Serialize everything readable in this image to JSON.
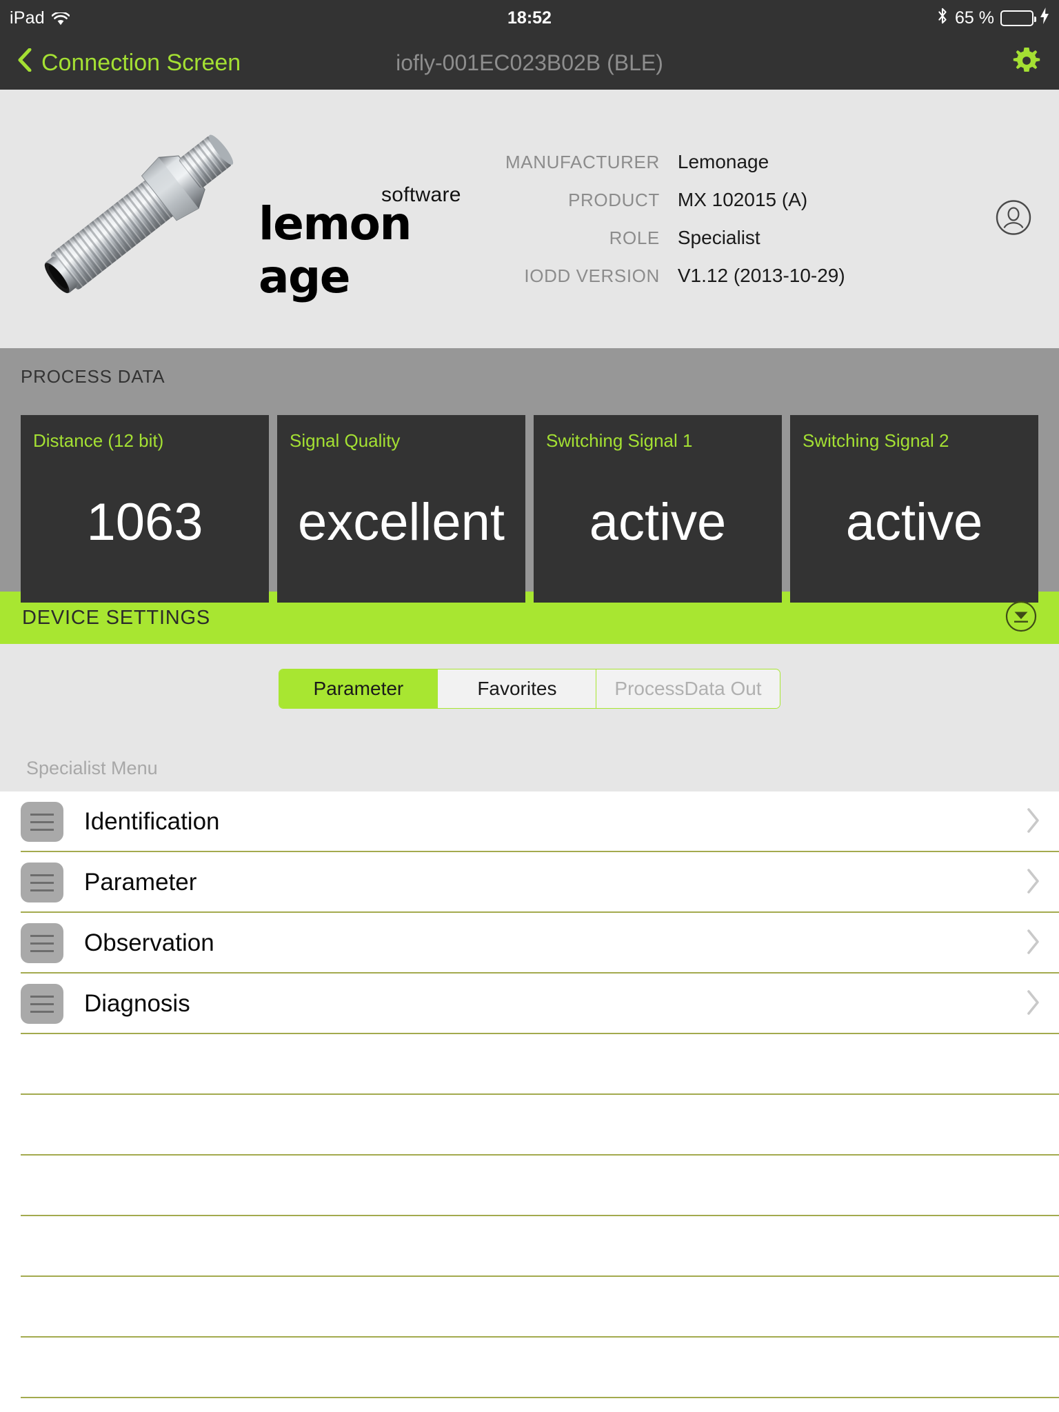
{
  "status_bar": {
    "carrier": "iPad",
    "wifi_icon": "wifi-icon",
    "time": "18:52",
    "bluetooth_icon": "bluetooth-icon",
    "battery_percent": "65 %",
    "battery_level": 65,
    "charging_icon": "lightning-bolt-icon",
    "battery_color": "#4cd964"
  },
  "nav_bar": {
    "back_label": "Connection Screen",
    "back_icon": "chevron-left-icon",
    "title": "iofly-001EC023B02B (BLE)",
    "settings_icon": "gear-icon",
    "accent_color": "#a4e033",
    "background": "#333333"
  },
  "device_panel": {
    "sensor_image_alt": "inductive-proximity-sensor",
    "logo": {
      "superscript": "software",
      "main": "lemon age",
      "word1": "lemon",
      "word2": "age"
    },
    "account_icon": "person-circle-icon",
    "info": [
      {
        "label": "MANUFACTURER",
        "value": "Lemonage"
      },
      {
        "label": "PRODUCT",
        "value": "MX 102015 (A)"
      },
      {
        "label": "ROLE",
        "value": "Specialist"
      },
      {
        "label": "IODD VERSION",
        "value": "V1.12 (2013-10-29)"
      }
    ]
  },
  "process_data": {
    "header": "PROCESS DATA",
    "background": "#979797",
    "card_background": "#333333",
    "label_color": "#a4e033",
    "cards": [
      {
        "label": "Distance (12 bit)",
        "value": "1063"
      },
      {
        "label": "Signal Quality",
        "value": "excellent"
      },
      {
        "label": "Switching Signal 1",
        "value": "active"
      },
      {
        "label": "Switching Signal 2",
        "value": "active"
      }
    ]
  },
  "device_settings": {
    "title": "DEVICE SETTINGS",
    "background": "#a8e631",
    "toggle_icon": "collapse-down-circle-icon"
  },
  "tabs": {
    "items": [
      {
        "label": "Parameter",
        "state": "active"
      },
      {
        "label": "Favorites",
        "state": "normal"
      },
      {
        "label": "ProcessData Out",
        "state": "disabled"
      }
    ]
  },
  "menu": {
    "header": "Specialist Menu",
    "separator_color": "#a3aa4e",
    "rows": [
      {
        "label": "Identification",
        "icon": "menu-lines-icon",
        "chevron": "chevron-right-icon",
        "empty": false
      },
      {
        "label": "Parameter",
        "icon": "menu-lines-icon",
        "chevron": "chevron-right-icon",
        "empty": false
      },
      {
        "label": "Observation",
        "icon": "menu-lines-icon",
        "chevron": "chevron-right-icon",
        "empty": false
      },
      {
        "label": "Diagnosis",
        "icon": "menu-lines-icon",
        "chevron": "chevron-right-icon",
        "empty": false
      },
      {
        "label": "",
        "icon": "",
        "chevron": "",
        "empty": true
      },
      {
        "label": "",
        "icon": "",
        "chevron": "",
        "empty": true
      },
      {
        "label": "",
        "icon": "",
        "chevron": "",
        "empty": true
      },
      {
        "label": "",
        "icon": "",
        "chevron": "",
        "empty": true
      },
      {
        "label": "",
        "icon": "",
        "chevron": "",
        "empty": true
      },
      {
        "label": "",
        "icon": "",
        "chevron": "",
        "empty": true
      }
    ]
  }
}
